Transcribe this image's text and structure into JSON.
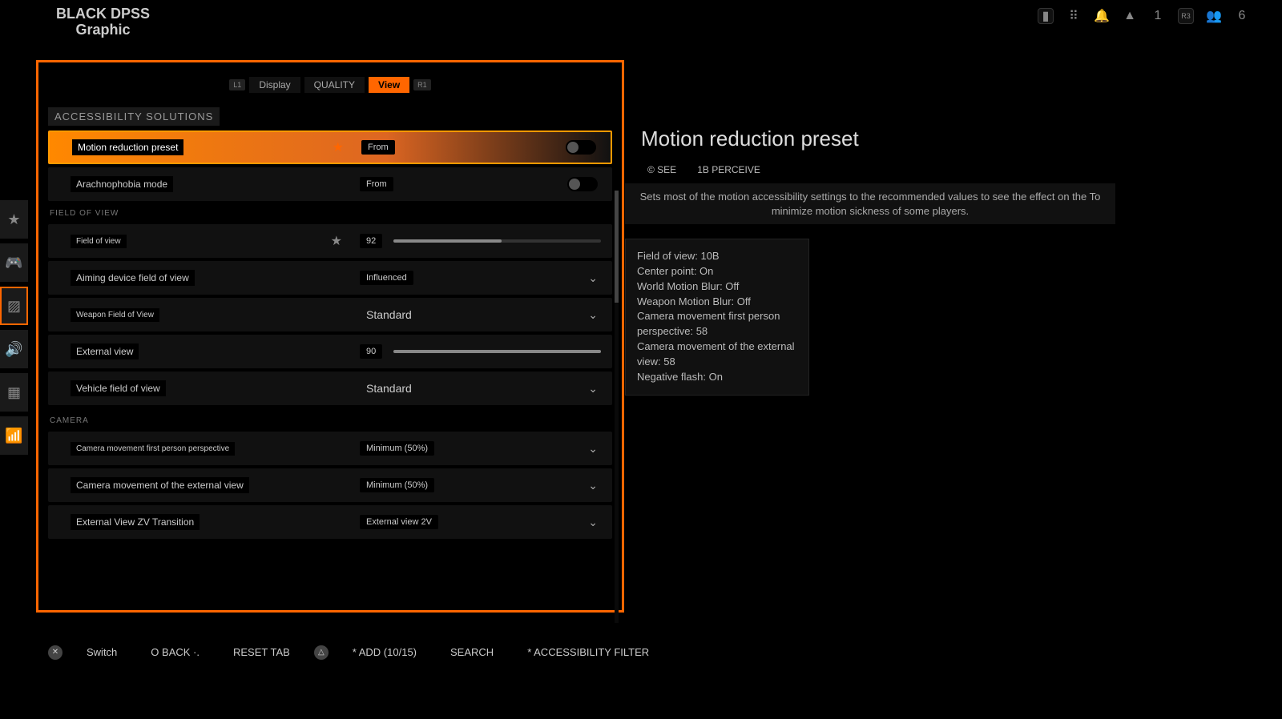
{
  "header": {
    "title_line1": "BLACK DPSS",
    "title_line2": "Graphic",
    "party_count": "1",
    "friends_count": "6"
  },
  "tabs": {
    "bumper_left": "L1",
    "display": "Display",
    "quality": "QUALITY",
    "view": "View",
    "bumper_right": "R1"
  },
  "sections": {
    "accessibility": "ACCESSIBILITY SOLUTIONS",
    "fov": "FIELD OF VIEW",
    "camera": "Camera"
  },
  "rows": {
    "motion_preset": {
      "label": "Motion reduction preset",
      "value": "From"
    },
    "arachnophobia": {
      "label": "Arachnophobia mode",
      "value": "From"
    },
    "fov": {
      "label": "Field of view",
      "value": "92",
      "slider_pct": 52
    },
    "aiming_fov": {
      "label": "Aiming device field of view",
      "value": "Influenced"
    },
    "weapon_fov": {
      "label": "Weapon Field of View",
      "value": "Standard"
    },
    "external": {
      "label": "External view",
      "value": "90",
      "slider_pct": 100
    },
    "vehicle_fov": {
      "label": "Vehicle field of view",
      "value": "Standard"
    },
    "cam_fp": {
      "label": "Camera movement first person perspective",
      "value": "Minimum (50%)"
    },
    "cam_ext": {
      "label": "Camera movement of the external view",
      "value": "Minimum (50%)"
    },
    "ext_transition": {
      "label": "External View ZV Transition",
      "value": "External view 2V"
    }
  },
  "info": {
    "title": "Motion reduction preset",
    "tag1": "© SEE",
    "tag2": "1B PERCEIVE",
    "desc": "Sets most of the motion accessibility settings to the recommended values to see the effect on the To minimize motion sickness of some players.",
    "details": "Field of view: 10B\nCenter point: On\nWorld Motion Blur: Off\nWeapon Motion Blur: Off\nCamera movement first person perspective: 58\nCamera movement of the external view: 58\nNegative flash: On"
  },
  "footer": {
    "switch": "Switch",
    "back": "O BACK ·.",
    "reset": "RESET TAB",
    "add": "* ADD (10/15)",
    "search": "SEARCH",
    "acc_filter": "* ACCESSIBILITY FILTER"
  }
}
